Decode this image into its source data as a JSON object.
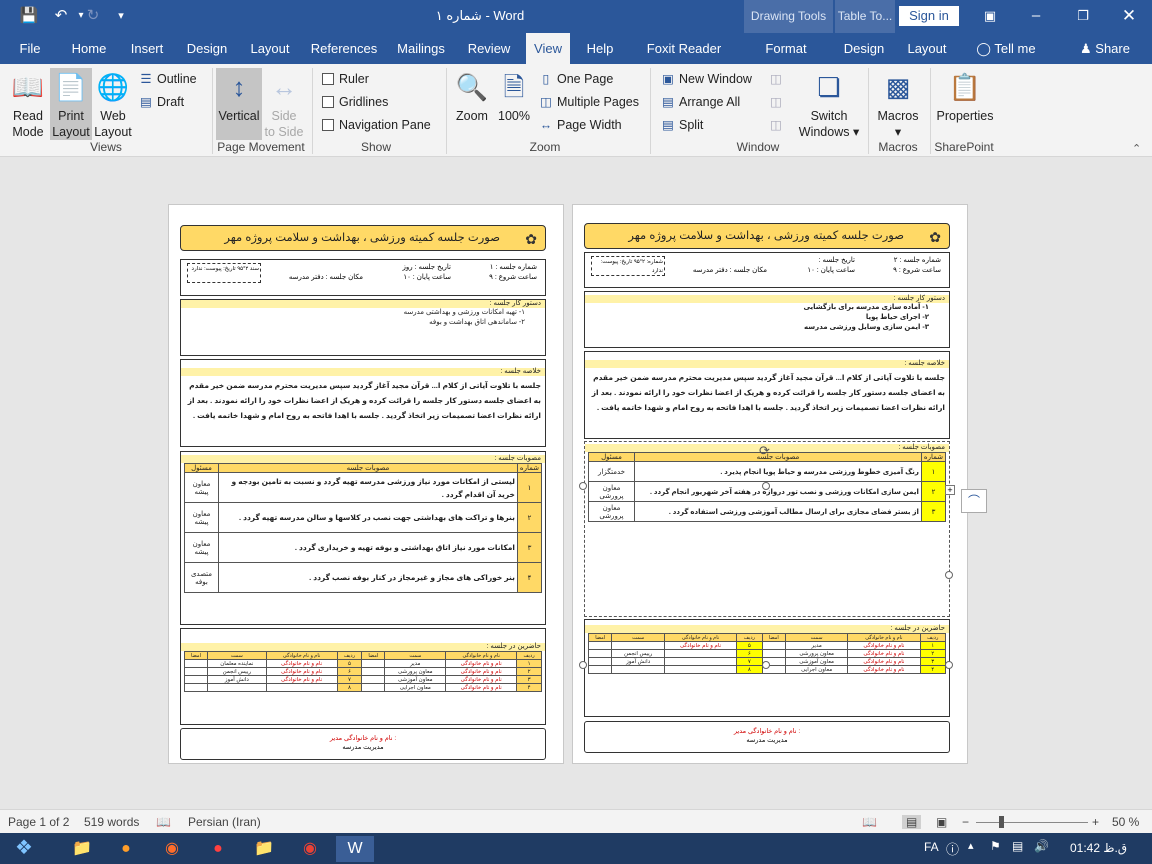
{
  "window": {
    "doc_title": "شماره ۱  -  Word",
    "drawing_tools": "Drawing Tools",
    "table_tools": "Table To...",
    "sign_in": "Sign in"
  },
  "qat": {
    "save_icon": "save-icon",
    "undo_icon": "undo-icon",
    "redo_icon": "redo-icon",
    "customize_icon": "customize-icon"
  },
  "tabs": [
    "File",
    "Home",
    "Insert",
    "Design",
    "Layout",
    "References",
    "Mailings",
    "Review",
    "View",
    "Help",
    "Foxit Reader PDF",
    "Format",
    "Design",
    "Layout"
  ],
  "active_tab": "View",
  "tell_me": "Tell me",
  "share": "Share",
  "ribbon": {
    "views": {
      "read_mode": [
        "Read",
        "Mode"
      ],
      "print_layout": [
        "Print",
        "Layout"
      ],
      "web_layout": [
        "Web",
        "Layout"
      ],
      "outline": "Outline",
      "draft": "Draft",
      "label": "Views"
    },
    "page_movement": {
      "vertical": "Vertical",
      "side_to_side": [
        "Side",
        "to Side"
      ],
      "label": "Page Movement"
    },
    "show": {
      "ruler": "Ruler",
      "gridlines": "Gridlines",
      "navigation_pane": "Navigation Pane",
      "label": "Show"
    },
    "zoom": {
      "zoom": "Zoom",
      "hundred": "100%",
      "one_page": "One Page",
      "multiple_pages": "Multiple Pages",
      "page_width": "Page Width",
      "label": "Zoom"
    },
    "window": {
      "new_window": "New Window",
      "arrange_all": "Arrange All",
      "split": "Split",
      "switch_windows": [
        "Switch",
        "Windows"
      ],
      "label": "Window"
    },
    "macros": {
      "macros": "Macros",
      "label": "Macros"
    },
    "sharepoint": {
      "properties": "Properties",
      "label": "SharePoint"
    }
  },
  "doc_left": {
    "header": "صورت جلسه کمیته ورزشی ، بهداشت و سلامت پروژه مهر",
    "info": {
      "meeting_no": "شماره جلسه : ۱",
      "date": "تاریخ جلسه : روز",
      "start": "ساعت شروع : ۹",
      "end": "ساعت پایان : ۱۰",
      "place": "مکان جلسه : دفتر مدرسه",
      "stamp": "سند ۲°۹۵ تاریخ: پیوست: ندارد"
    },
    "agenda_title": "دستور کار جلسه :",
    "agenda": [
      "۱- تهیه امکانات ورزشی و بهداشتی مدرسه",
      "۲- ساماندهی اتاق بهداشت و بوفه"
    ],
    "summary_title": "خلاصه جلسه :",
    "summary": "جلسه با تلاوت آیاتی از کلام ا... قرآن مجید آغاز گردید سپس مدیریت محترم مدرسه ضمن خیر مقدم به اعضای جلسه دستور کار جلسه را قرائت کرده و هریک از اعضا نظرات خود را ارائه نمودند . بعد از ارائه نظرات اعضا تصمیمات زیر اتخاذ گردید . جلسه با اهدا فاتحه به روح امام و شهدا خاتمه یافت .",
    "decisions_title": "مصوبات جلسه :",
    "decisions_cols": [
      "شماره",
      "مصوبات جلسه",
      "مسئول"
    ],
    "decisions": [
      {
        "n": "۱",
        "text": "لیستی از امکانات مورد نیاز ورزشی مدرسه تهیه گردد و نسبت به تامین بودجه و خرید آن اقدام گردد .",
        "resp": "معاون پیشه"
      },
      {
        "n": "۲",
        "text": "بنرها و تراکت های بهداشتی جهت نصب در کلاسها و سالن مدرسه تهیه گردد .",
        "resp": "معاون پیشه"
      },
      {
        "n": "۳",
        "text": "امکانات مورد نیاز اتاق بهداشتی و بوفه تهیه و خریداری گردد .",
        "resp": "معاون پیشه"
      },
      {
        "n": "۴",
        "text": "بنر خوراکی های مجاز و غیرمجاز در کنار بوفه نصب گردد .",
        "resp": "متصدی بوفه"
      }
    ],
    "attendees_title": "حاضرین در جلسه :",
    "attendees": [
      {
        "n": "۱",
        "name": "نام و نام خانوادگی",
        "role": "مدیر",
        "n2": "۵",
        "name2": "نام و نام خانوادگی",
        "role2": "نماینده معلمان"
      },
      {
        "n": "۲",
        "name": "نام و نام خانوادگی",
        "role": "معاون پرورشی",
        "n2": "۶",
        "name2": "نام و نام خانوادگی",
        "role2": "رییس انجمن"
      },
      {
        "n": "۳",
        "name": "نام و نام خانوادگی",
        "role": "معاون آموزشی",
        "n2": "۷",
        "name2": "نام و نام خانوادگی",
        "role2": "دانش آموز"
      },
      {
        "n": "۴",
        "name": "نام و نام خانوادگی",
        "role": "معاون اجرایی",
        "n2": "۸",
        "name2": "",
        "role2": ""
      }
    ],
    "signature": [
      "نام و نام خانوادگی مدیر :",
      "مدیریت مدرسه"
    ]
  },
  "doc_right": {
    "header": "صورت جلسه کمیته ورزشی ، بهداشت و سلامت پروژه مهر",
    "info": {
      "meeting_no": "شماره جلسه : ۲",
      "date": "تاریخ جلسه :",
      "start": "ساعت شروع : ۹",
      "end": "ساعت پایان : ۱۰",
      "place": "مکان جلسه : دفتر مدرسه",
      "stamp": "شماره: ۲°۹۵ تاریخ: پیوست: ندارد"
    },
    "agenda_title": "دستور کار جلسه :",
    "agenda": [
      "۱- آماده سازی مدرسه برای بازگشایی",
      "۲- اجرای حیاط پویا",
      "۳- ایمن سازی وسایل ورزشی مدرسه"
    ],
    "summary_title": "خلاصه جلسه :",
    "summary": "جلسه با تلاوت آیاتی از کلام ا... قرآن مجید آغاز گردید سپس مدیریت محترم مدرسه ضمن خیر مقدم به اعضای جلسه دستور کار جلسه را قرائت کرده و هریک از اعضا نظرات خود را ارائه نمودند . بعد از ارائه نظرات اعضا تصمیمات زیر اتخاذ گردید . جلسه با اهدا فاتحه به روح امام و شهدا خاتمه یافت .",
    "decisions_title": "مصوبات جلسه :",
    "decisions_cols": [
      "شماره",
      "مصوبات جلسه",
      "مسئول"
    ],
    "decisions": [
      {
        "n": "۱",
        "text": "رنگ آمیزی خطوط ورزشی مدرسه و حیاط پویا انجام پذیرد .",
        "resp": "خدمتگزار"
      },
      {
        "n": "۲",
        "text": "ایمن سازی امکانات ورزشی و نصب تور دروازه در هفته آخر شهریور انجام گردد .",
        "resp": "معاون پرورشی"
      },
      {
        "n": "۳",
        "text": "از بستر فضای مجازی برای ارسال مطالب آموزشی ورزشی استفاده گردد .",
        "resp": "معاون پرورشی"
      }
    ],
    "attendees_title": "حاضرین در جلسه :",
    "attendees": [
      {
        "n": "۱",
        "name": "نام و نام خانوادگی",
        "role": "مدیر",
        "n2": "۵",
        "name2": "نام و نام خانوادگی",
        "role2": ""
      },
      {
        "n": "۲",
        "name": "نام و نام خانوادگی",
        "role": "معاون پرورشی",
        "n2": "۶",
        "name2": "",
        "role2": "رییس انجمن"
      },
      {
        "n": "۳",
        "name": "نام و نام خانوادگی",
        "role": "معاون آموزشی",
        "n2": "۷",
        "name2": "",
        "role2": "دانش آموز"
      },
      {
        "n": "۴",
        "name": "نام و نام خانوادگی",
        "role": "معاون اجرایی",
        "n2": "۸",
        "name2": "",
        "role2": ""
      }
    ],
    "signature": [
      "نام و نام خانوادگی مدیر :",
      "مدیریت مدرسه"
    ]
  },
  "status": {
    "page": "Page 1 of 2",
    "words": "519 words",
    "language": "Persian (Iran)",
    "zoom": "50 %",
    "zoom_level": 50
  },
  "taskbar": {
    "lang": "FA",
    "time": "ق.ظ 01:42"
  },
  "colors": {
    "title_blue": "#2b579a",
    "header_yellow": "#ffd966",
    "number_yellow": "#ffff00",
    "name_red": "#d00000"
  }
}
